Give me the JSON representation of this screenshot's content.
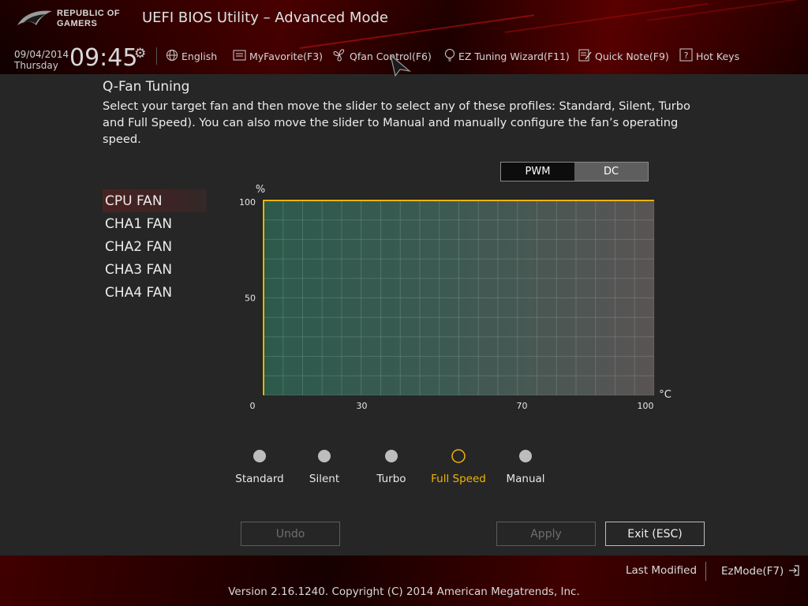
{
  "header": {
    "logo_line1": "REPUBLIC OF",
    "logo_line2": "GAMERS",
    "title": "UEFI BIOS Utility – Advanced Mode",
    "date": "09/04/2014",
    "day": "Thursday",
    "time": "09:45",
    "nav": [
      {
        "label": "English",
        "icon": "globe-icon"
      },
      {
        "label": "MyFavorite(F3)",
        "icon": "favorite-icon"
      },
      {
        "label": "Qfan Control(F6)",
        "icon": "fan-icon"
      },
      {
        "label": "EZ Tuning Wizard(F11)",
        "icon": "lightbulb-icon"
      },
      {
        "label": "Quick Note(F9)",
        "icon": "note-icon"
      },
      {
        "label": "Hot Keys",
        "icon": "question-icon"
      }
    ]
  },
  "main": {
    "title": "Q-Fan Tuning",
    "description": "Select your target fan and then move the slider to select any of these profiles: Standard, Silent, Turbo and Full Speed). You can also move the slider to Manual and manually configure the fan’s operating speed.",
    "mode_toggle": {
      "options": [
        "PWM",
        "DC"
      ],
      "selected": "PWM"
    },
    "fans": [
      "CPU FAN",
      "CHA1 FAN",
      "CHA2 FAN",
      "CHA3 FAN",
      "CHA4 FAN"
    ],
    "selected_fan": "CPU FAN"
  },
  "chart_data": {
    "type": "line",
    "ylabel": "%",
    "xlabel": "°C",
    "x_ticks": [
      0,
      30,
      70,
      100
    ],
    "y_ticks": [
      50,
      100
    ],
    "xlim": [
      0,
      100
    ],
    "ylim": [
      0,
      100
    ],
    "grid": true,
    "line_color": "#f2b400",
    "series": [
      {
        "x": [
          0,
          0,
          100
        ],
        "y": [
          0,
          100,
          100
        ]
      }
    ]
  },
  "profiles": {
    "options": [
      "Standard",
      "Silent",
      "Turbo",
      "Full Speed",
      "Manual"
    ],
    "selected": "Full Speed"
  },
  "buttons": {
    "undo": "Undo",
    "apply": "Apply",
    "exit": "Exit (ESC)"
  },
  "footer": {
    "last_modified": "Last Modified",
    "ezmode": "EzMode(F7)",
    "version": "Version 2.16.1240. Copyright (C) 2014 American Megatrends, Inc."
  },
  "colors": {
    "accent": "#f2b400",
    "brand_red": "#8b0000",
    "chart_fill": "#2f5e50"
  }
}
